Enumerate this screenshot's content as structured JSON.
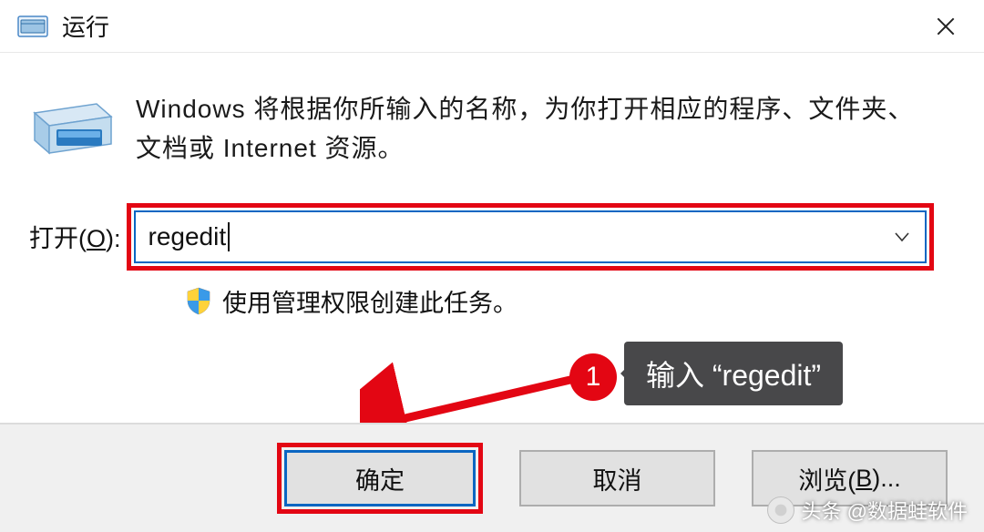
{
  "titlebar": {
    "title": "运行"
  },
  "content": {
    "description": "Windows 将根据你所输入的名称，为你打开相应的程序、文件夹、文档或 Internet 资源。",
    "open_label_prefix": "打开(",
    "open_label_hotkey": "O",
    "open_label_suffix": "):",
    "input_value": "regedit",
    "admin_note": "使用管理权限创建此任务。"
  },
  "annotation": {
    "step_number": "1",
    "tooltip_text": "输入 “regedit”"
  },
  "buttons": {
    "ok": "确定",
    "cancel": "取消",
    "browse_prefix": "浏览(",
    "browse_hotkey": "B",
    "browse_suffix": ")..."
  },
  "watermark": {
    "text": "头条 @数据蛙软件"
  }
}
